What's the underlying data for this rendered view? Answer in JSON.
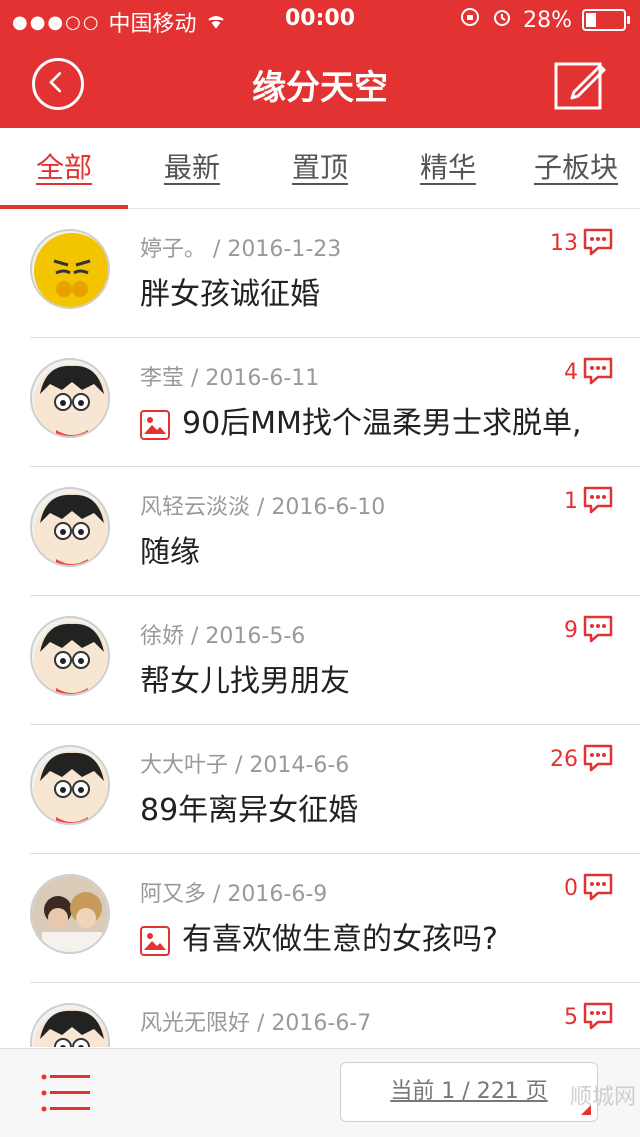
{
  "status_bar": {
    "signal": "●●●○○",
    "carrier": "中国移动",
    "time": "00:00",
    "battery": "28%"
  },
  "nav": {
    "title": "缘分天空"
  },
  "tabs": [
    {
      "label": "全部"
    },
    {
      "label": "最新"
    },
    {
      "label": "置顶"
    },
    {
      "label": "精华"
    },
    {
      "label": "子板块"
    }
  ],
  "posts": [
    {
      "author_date": "婷子。 / 2016-1-23",
      "count": "13",
      "title": "胖女孩诚征婚",
      "has_image": false
    },
    {
      "author_date": "李莹 / 2016-6-11",
      "count": "4",
      "title": "90后MM找个温柔男士求脱单,",
      "has_image": true
    },
    {
      "author_date": "风轻云淡淡 / 2016-6-10",
      "count": "1",
      "title": "随缘",
      "has_image": false
    },
    {
      "author_date": "徐娇 / 2016-5-6",
      "count": "9",
      "title": "帮女儿找男朋友",
      "has_image": false
    },
    {
      "author_date": "大大叶子 / 2014-6-6",
      "count": "26",
      "title": "89年离异女征婚",
      "has_image": false
    },
    {
      "author_date": "阿又多 / 2016-6-9",
      "count": "0",
      "title": "有喜欢做生意的女孩吗?",
      "has_image": true
    },
    {
      "author_date": "风光无限好 / 2016-6-7",
      "count": "5",
      "title": "",
      "has_image": false
    }
  ],
  "bottom_bar": {
    "pager_text": "当前 1 / 221 页",
    "watermark": "顺城网"
  },
  "colors": {
    "accent": "#e23232"
  }
}
